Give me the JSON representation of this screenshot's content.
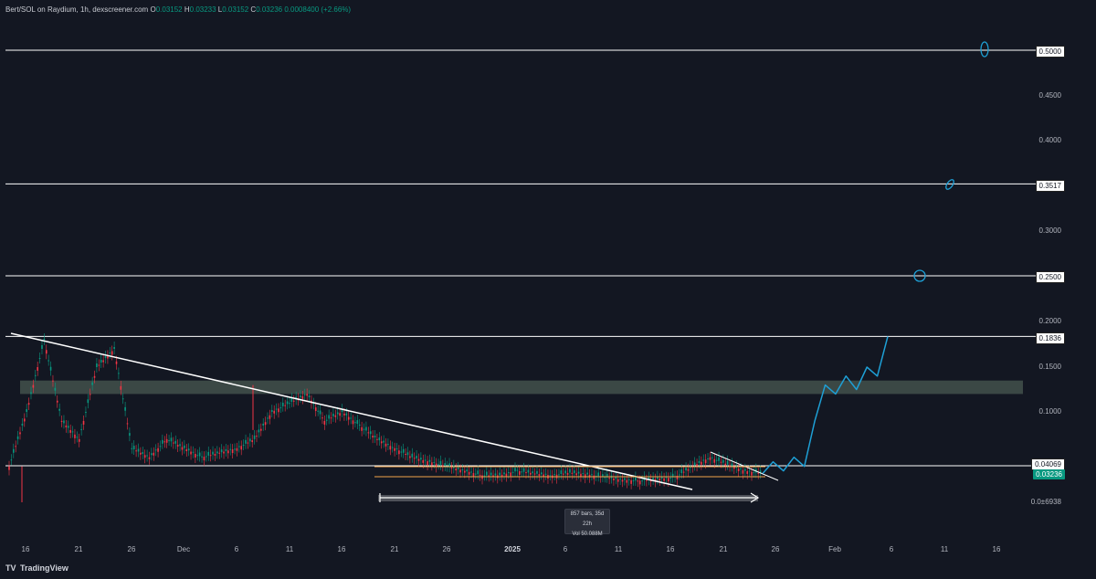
{
  "header": {
    "symbol": "Bert/SOL on Raydium, 1h, dexscreener.com",
    "open_label": "O",
    "open": "0.03152",
    "high_label": "H",
    "high": "0.03233",
    "low_label": "L",
    "low": "0.03152",
    "close_label": "C",
    "close": "0.03236",
    "change": "0.0008400 (+2.66%)"
  },
  "chart_data": {
    "type": "line",
    "title": "",
    "xlabel": "",
    "ylabel": "",
    "x_ticks": [
      "16",
      "21",
      "26",
      "Dec",
      "6",
      "11",
      "16",
      "21",
      "26",
      "2025",
      "6",
      "11",
      "16",
      "21",
      "26",
      "Feb",
      "6",
      "11",
      "16"
    ],
    "y_ticks": [
      "0.4500",
      "0.4000",
      "0.3000",
      "0.2000",
      "0.1500",
      "0.1000",
      "0.0±6938"
    ],
    "ylim": [
      0.0,
      0.5
    ],
    "horizontal_levels": [
      "0.5000",
      "0.3517",
      "0.2500",
      "0.1836",
      "0.04069"
    ],
    "last_price": "0.03236",
    "resistance_zone": [
      0.12,
      0.135
    ],
    "series": [
      {
        "values": [
          0.04,
          0.1,
          0.18,
          0.09,
          0.07,
          0.15,
          0.17,
          0.06,
          0.05,
          0.07,
          0.06,
          0.05,
          0.055,
          0.06,
          0.07,
          0.1,
          0.11,
          0.12,
          0.09,
          0.1,
          0.085,
          0.07,
          0.06,
          0.05,
          0.045,
          0.04,
          0.035,
          0.03,
          0.03,
          0.035,
          0.032,
          0.03,
          0.033,
          0.031,
          0.028,
          0.025,
          0.024,
          0.026,
          0.028,
          0.04,
          0.05,
          0.042,
          0.035,
          0.032
        ]
      }
    ],
    "projection": [
      0.032,
      0.045,
      0.035,
      0.05,
      0.04,
      0.09,
      0.13,
      0.12,
      0.14,
      0.125,
      0.15,
      0.14,
      0.1836
    ]
  },
  "measure": {
    "bars": "857 bars, 35d 22h",
    "vol": "Vol 50.088M"
  },
  "footer": {
    "brand": "TradingView"
  },
  "colors": {
    "background": "#131722",
    "candle_up": "#089981",
    "candle_down": "#f23645",
    "level_line": "#ffffff",
    "zone": "#4a5a52",
    "drawing": "#1ea0d6",
    "support_line": "#f0a34a"
  }
}
